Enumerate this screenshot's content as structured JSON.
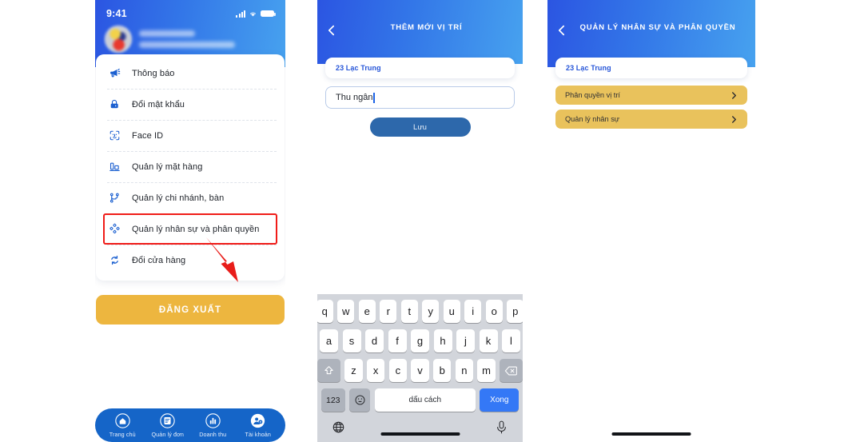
{
  "screen1": {
    "status_bar": {
      "time": "9:41",
      "signal_icon": "cellular-bars-icon",
      "wifi_icon": "wifi-icon",
      "battery_icon": "battery-icon"
    },
    "profile": {
      "avatar_icon": "user-avatar",
      "name_redacted": "",
      "address_redacted": ""
    },
    "menu": [
      {
        "icon": "megaphone-icon",
        "label": "Thông báo",
        "highlighted": false
      },
      {
        "icon": "lock-icon",
        "label": "Đổi mật khẩu",
        "highlighted": false
      },
      {
        "icon": "face-id-icon",
        "label": "Face ID",
        "highlighted": false
      },
      {
        "icon": "inventory-icon",
        "label": "Quản lý mặt hàng",
        "highlighted": false
      },
      {
        "icon": "branch-tree-icon",
        "label": "Quản lý chi nhánh, bàn",
        "highlighted": false
      },
      {
        "icon": "permissions-nodes-icon",
        "label": "Quản lý nhân sự và phân quyền",
        "highlighted": true
      },
      {
        "icon": "swap-store-icon",
        "label": "Đổi cửa hàng",
        "highlighted": false
      }
    ],
    "logout_label": "ĐĂNG XUẤT",
    "tabbar": [
      {
        "icon": "home-icon",
        "label": "Trang chủ"
      },
      {
        "icon": "orders-icon",
        "label": "Quản lý đơn"
      },
      {
        "icon": "revenue-chart-icon",
        "label": "Doanh thu"
      },
      {
        "icon": "account-icon",
        "label": "Tài khoản"
      }
    ],
    "annotation": {
      "highlight_color": "#f01c18",
      "arrow_color": "#e81d1a",
      "arrow_icon": "pointer-arrow-icon"
    }
  },
  "screen2": {
    "back_icon": "chevron-left-icon",
    "title": "THÊM MỚI VỊ TRÍ",
    "store_pill": "23 Lạc Trung",
    "input_value": "Thu ngân",
    "save_label": "Lưu",
    "keyboard": {
      "row1": [
        "q",
        "w",
        "e",
        "r",
        "t",
        "y",
        "u",
        "i",
        "o",
        "p"
      ],
      "row2": [
        "a",
        "s",
        "d",
        "f",
        "g",
        "h",
        "j",
        "k",
        "l"
      ],
      "row3": [
        "z",
        "x",
        "c",
        "v",
        "b",
        "n",
        "m"
      ],
      "shift_icon": "shift-icon",
      "backspace_icon": "backspace-icon",
      "numbers_label": "123",
      "emoji_icon": "emoji-icon",
      "space_label": "dấu cách",
      "done_label": "Xong",
      "globe_icon": "globe-icon",
      "mic_icon": "microphone-icon"
    }
  },
  "screen3": {
    "back_icon": "chevron-left-icon",
    "title": "QUẢN LÝ NHÂN SỰ VÀ PHÂN QUYỀN",
    "store_pill": "23 Lạc Trung",
    "rows": [
      {
        "label": "Phân quyền vị trí",
        "chevron_icon": "chevron-right-icon"
      },
      {
        "label": "Quản lý nhân sự",
        "chevron_icon": "chevron-right-icon"
      }
    ]
  },
  "colors": {
    "header_gradient_start": "#2b55e2",
    "header_gradient_end": "#47a2ef",
    "gold": "#e9c25c",
    "logout_gold": "#edb63f",
    "tabbar_blue": "#1565c8",
    "accent_blue": "#1a5fd0",
    "done_key_blue": "#3478f6"
  }
}
